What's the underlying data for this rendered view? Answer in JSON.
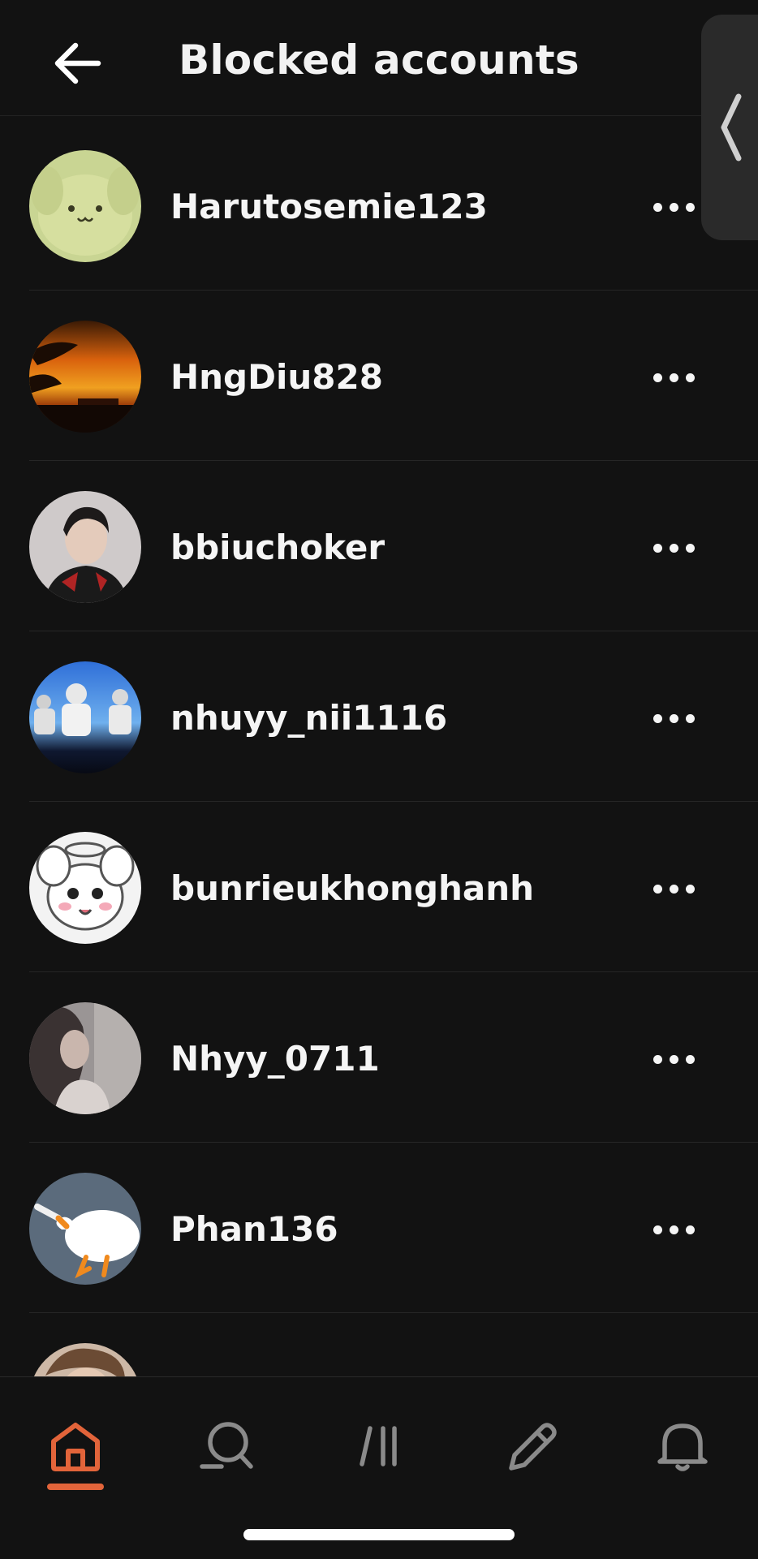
{
  "header": {
    "title": "Blocked accounts",
    "back_icon": "arrow-left-icon"
  },
  "side_tab": {
    "icon": "chevron-left-icon"
  },
  "accounts": [
    {
      "username": "Harutosemie123",
      "avatar": "yellow-plush-dog"
    },
    {
      "username": "HngDiu828",
      "avatar": "orange-sunset"
    },
    {
      "username": "bbiuchoker",
      "avatar": "man-portrait"
    },
    {
      "username": "nhuyy_nii1116",
      "avatar": "stage-performers"
    },
    {
      "username": "bunrieukhonghanh",
      "avatar": "cartoon-white-cat"
    },
    {
      "username": "Nhyy_0711",
      "avatar": "blurry-woman"
    },
    {
      "username": "Phan136",
      "avatar": "white-goose"
    },
    {
      "username": "",
      "avatar": "partial-portrait"
    }
  ],
  "row_menu_icon": "more-horizontal-icon",
  "bottom_nav": {
    "items": [
      "home-icon",
      "search-icon",
      "feed-icon",
      "compose-icon",
      "bell-icon"
    ],
    "active": "home-icon"
  },
  "colors": {
    "background": "#121212",
    "accent": "#e2643a",
    "text": "#f5f5f5",
    "divider": "#262626",
    "inactive_icon": "#8a8a8a"
  }
}
